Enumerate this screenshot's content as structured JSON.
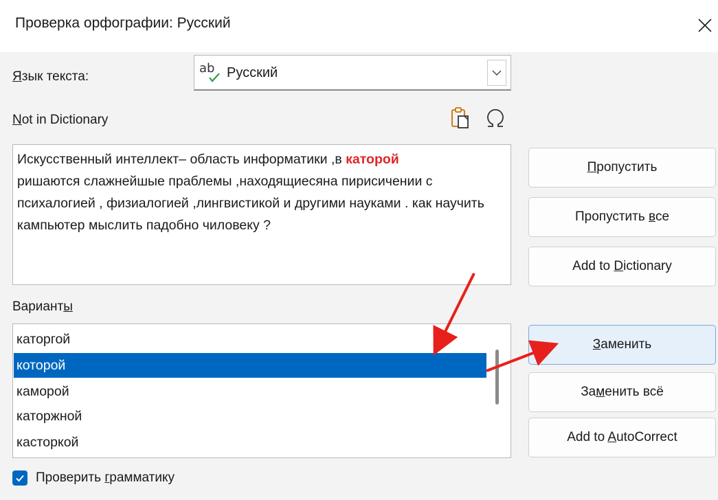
{
  "dialog": {
    "title": "Проверка орфографии: Русский"
  },
  "language": {
    "label_u": "Я",
    "label_rest": "зык текста:",
    "value": "Русский"
  },
  "not_in_dictionary": {
    "label_u": "N",
    "label_rest": "ot in Dictionary",
    "text_before": "Искусственный интеллект– область информатики ,в ",
    "error_word": "каторой",
    "text_after": "ришаются слажнейшые праблемы ,находящиесяна пирисичении с психалогией , физиалогией ,лингвистикой и другими науками . как научить кампьютер мыслить падобно чиловеку ?"
  },
  "suggestions": {
    "label_main": "Вариант",
    "label_u": "ы",
    "items": [
      "каторгой",
      "которой",
      "каморой",
      "каторжной",
      "касторкой"
    ],
    "selected_index": 1
  },
  "buttons": {
    "ignore_u": "П",
    "ignore_rest": "ропустить",
    "ignore_all_main": "Пропустить ",
    "ignore_all_u": "в",
    "ignore_all_rest": "се",
    "add_dict_main": "Add to ",
    "add_dict_u": "D",
    "add_dict_rest": "ictionary",
    "replace_u": "З",
    "replace_rest": "аменить",
    "replace_all_main": "За",
    "replace_all_u": "м",
    "replace_all_rest": "енить всё",
    "add_autocorrect_main": "Add to ",
    "add_autocorrect_u": "A",
    "add_autocorrect_rest": "utoCorrect"
  },
  "grammar": {
    "label_main": "Проверить ",
    "label_u": "г",
    "label_rest": "рамматику",
    "checked": true
  },
  "colors": {
    "accent": "#0067c0",
    "error": "#e0262a",
    "arrow": "#e8201c"
  }
}
